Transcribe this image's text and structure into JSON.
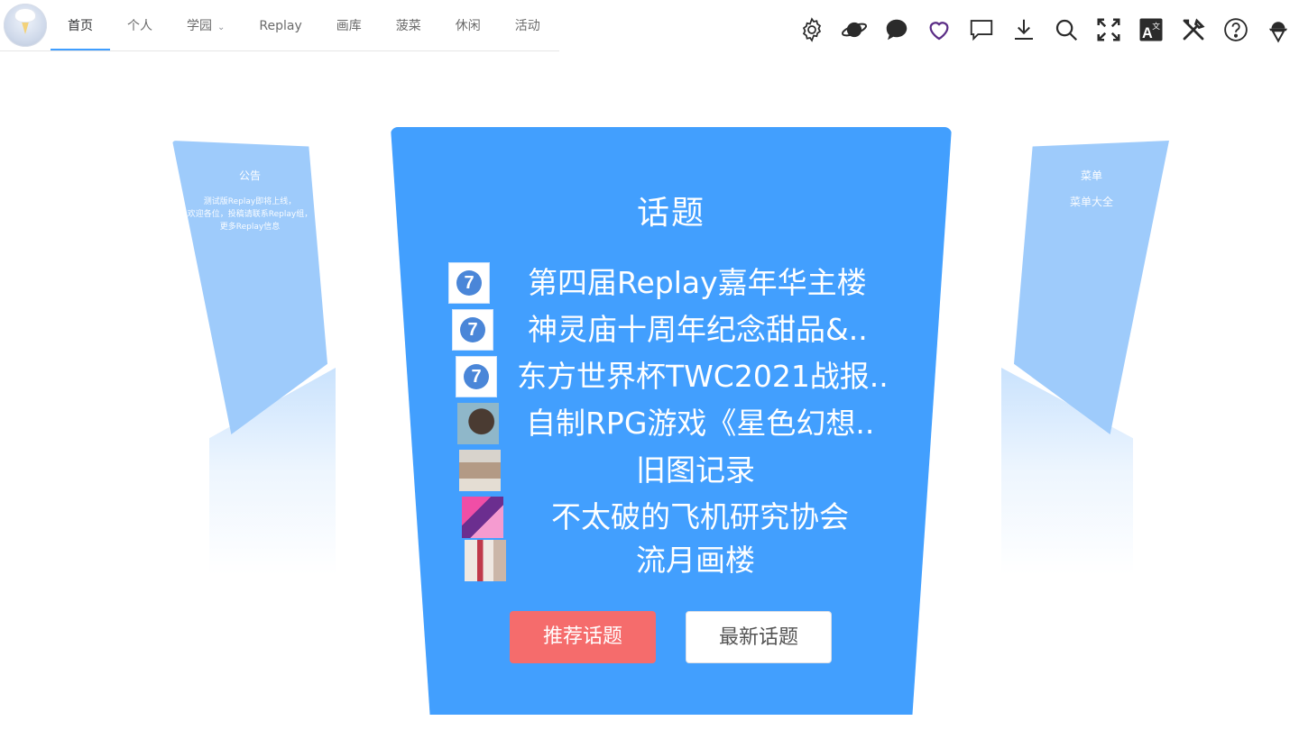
{
  "logo": {
    "icon": "ice-cream-logo-icon"
  },
  "nav": {
    "tabs": [
      {
        "label": "首页",
        "active": true
      },
      {
        "label": "个人"
      },
      {
        "label": "学园",
        "dropdown": true
      },
      {
        "label": "Replay"
      },
      {
        "label": "画库"
      },
      {
        "label": "菠菜"
      },
      {
        "label": "休闲"
      },
      {
        "label": "活动"
      }
    ]
  },
  "toolbar": {
    "icons": [
      "gear-icon",
      "planet-icon",
      "chat-bubble-filled-icon",
      "heart-icon",
      "message-icon",
      "download-icon",
      "search-icon",
      "fullscreen-icon",
      "translate-icon",
      "tools-icon",
      "help-icon",
      "ice-cream-icon"
    ],
    "accent": "#5b2d86",
    "icon_color": "#2b2b2b"
  },
  "left_card": {
    "title": "公告",
    "lines": [
      "测试版Replay即将上线，",
      "欢迎各位，投稿请联系Replay组，",
      "更多Replay信息"
    ]
  },
  "right_card": {
    "title": "菜单",
    "lines": [
      "菜单大全"
    ]
  },
  "main_card": {
    "title": "话题",
    "topics": [
      {
        "text": "第四届Replay嘉年华主楼",
        "thumb": "seven"
      },
      {
        "text": "神灵庙十周年纪念甜品&..",
        "thumb": "seven"
      },
      {
        "text": "东方世界杯TWC2021战报..",
        "thumb": "seven"
      },
      {
        "text": "自制RPG游戏《星色幻想..",
        "thumb": "photo1"
      },
      {
        "text": "旧图记录",
        "thumb": "photo2"
      },
      {
        "text": "不太破的飞机研究协会",
        "thumb": "photo3"
      },
      {
        "text": "流月画楼",
        "thumb": "photo4"
      }
    ],
    "seven_glyph": "7",
    "buttons": {
      "recommended": "推荐话题",
      "latest": "最新话题"
    },
    "colors": {
      "card": "#429ffe",
      "recommended": "#f56c6c"
    }
  }
}
